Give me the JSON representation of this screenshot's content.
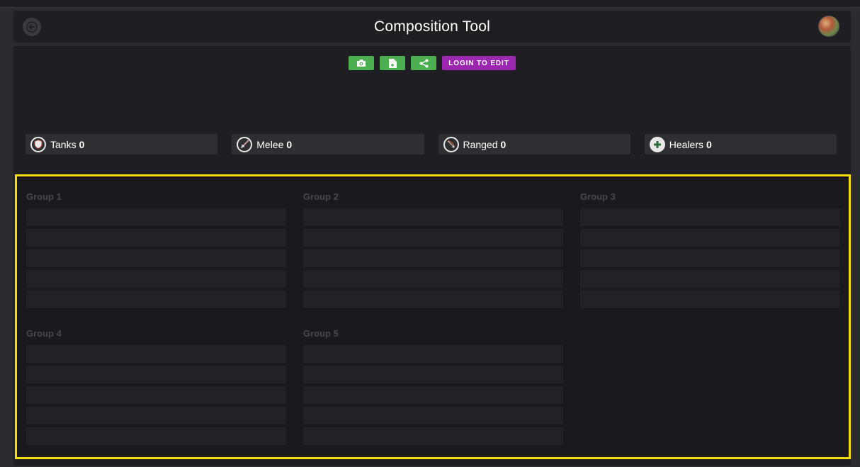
{
  "header": {
    "title": "Composition Tool",
    "back_icon": "arrow-left-icon",
    "avatar_icon": "user-avatar"
  },
  "toolbar": {
    "buttons": [
      {
        "icon": "camera-icon"
      },
      {
        "icon": "file-export-icon"
      },
      {
        "icon": "share-icon"
      }
    ],
    "login_label": "LOGIN TO EDIT",
    "colors": {
      "action": "#4caf50",
      "login": "#9c27b0"
    }
  },
  "roles": [
    {
      "label": "Tanks",
      "count": "0",
      "icon": "shield-icon"
    },
    {
      "label": "Melee",
      "count": "0",
      "icon": "sword-icon"
    },
    {
      "label": "Ranged",
      "count": "0",
      "icon": "bow-icon"
    },
    {
      "label": "Healers",
      "count": "0",
      "icon": "plus-icon"
    }
  ],
  "groups": [
    {
      "title": "Group 1",
      "slots": 5
    },
    {
      "title": "Group 2",
      "slots": 5
    },
    {
      "title": "Group 3",
      "slots": 5
    },
    {
      "title": "Group 4",
      "slots": 5
    },
    {
      "title": "Group 5",
      "slots": 5
    }
  ],
  "highlight_color": "#f5de0c"
}
